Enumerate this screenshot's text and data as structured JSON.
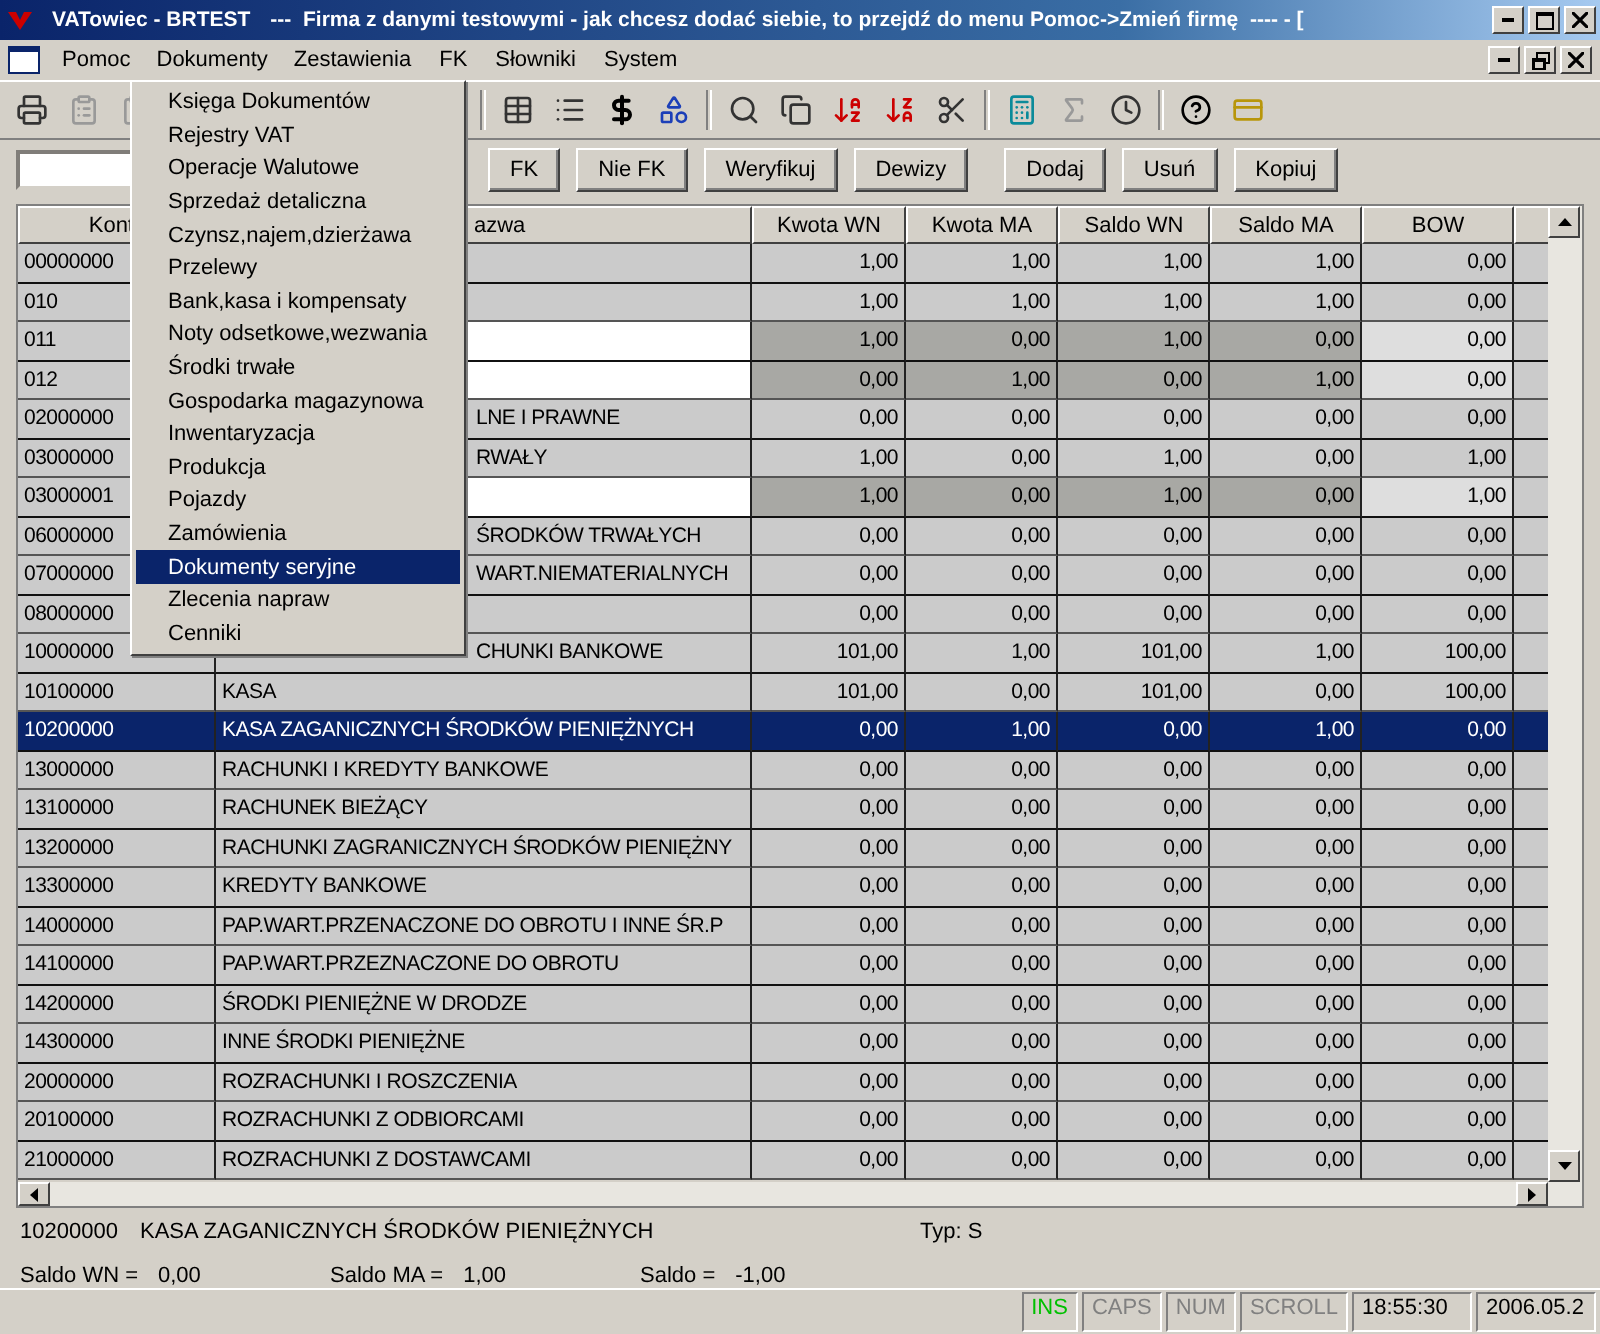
{
  "window": {
    "title": "VATowiec - BRTEST",
    "caption": "---  Firma z danymi testowymi - jak chcesz dodać siebie, to przejdź do menu Pomoc->Zmień firmę  ---- - ["
  },
  "menu": [
    {
      "label": "Pomoc",
      "selected": false
    },
    {
      "label": "Dokumenty",
      "selected": true
    },
    {
      "label": "Zestawienia",
      "selected": false
    },
    {
      "label": "FK",
      "selected": false
    },
    {
      "label": "Słowniki",
      "selected": false
    },
    {
      "label": "System",
      "selected": false
    }
  ],
  "dropdown": [
    {
      "label": "Księga Dokumentów",
      "selected": false
    },
    {
      "label": "Rejestry VAT",
      "selected": false
    },
    {
      "label": "Operacje Walutowe",
      "selected": false
    },
    {
      "label": "Sprzedaż detaliczna",
      "selected": false
    },
    {
      "label": "Czynsz,najem,dzierżawa",
      "selected": false
    },
    {
      "label": "Przelewy",
      "selected": false
    },
    {
      "label": "Bank,kasa i kompensaty",
      "selected": false
    },
    {
      "label": "Noty odsetkowe,wezwania",
      "selected": false
    },
    {
      "label": "Środki trwałe",
      "selected": false
    },
    {
      "label": "Gospodarka magazynowa",
      "selected": false
    },
    {
      "label": "Inwentaryzacja",
      "selected": false
    },
    {
      "label": "Produkcja",
      "selected": false
    },
    {
      "label": "Pojazdy",
      "selected": false
    },
    {
      "label": "Zamówienia",
      "selected": false
    },
    {
      "label": "Dokumenty seryjne",
      "selected": true
    },
    {
      "label": "Zlecenia napraw",
      "selected": false
    },
    {
      "label": "Cenniki",
      "selected": false
    }
  ],
  "buttons": [
    "FK",
    "Nie FK",
    "Weryfikuj",
    "Dewizy",
    "Dodaj",
    "Usuń",
    "Kopiuj"
  ],
  "table": {
    "columns": [
      "Kont",
      "azwa",
      "Kwota WN",
      "Kwota MA",
      "Saldo WN",
      "Saldo MA",
      "BOW"
    ],
    "rows": [
      {
        "code": "00000000",
        "values": [
          "1,00",
          "1,00",
          "1,00",
          "1,00",
          "0,00"
        ],
        "kind": "normal",
        "selected": false
      },
      {
        "code": "010",
        "values": [
          "1,00",
          "1,00",
          "1,00",
          "1,00",
          "0,00"
        ],
        "kind": "normal",
        "selected": false
      },
      {
        "code": "011",
        "values": [
          "1,00",
          "0,00",
          "1,00",
          "0,00",
          "0,00"
        ],
        "kind": "marked",
        "selected": false
      },
      {
        "code": "012",
        "values": [
          "0,00",
          "1,00",
          "0,00",
          "1,00",
          "0,00"
        ],
        "kind": "marked",
        "selected": false
      },
      {
        "code": "02000000",
        "name": "LNE I PRAWNE",
        "values": [
          "0,00",
          "0,00",
          "0,00",
          "0,00",
          "0,00"
        ],
        "kind": "normal",
        "selected": false
      },
      {
        "code": "03000000",
        "name": "RWAŁY",
        "values": [
          "1,00",
          "0,00",
          "1,00",
          "0,00",
          "1,00"
        ],
        "kind": "normal",
        "selected": false
      },
      {
        "code": "03000001",
        "values": [
          "1,00",
          "0,00",
          "1,00",
          "0,00",
          "1,00"
        ],
        "kind": "marked",
        "selected": false
      },
      {
        "code": "06000000",
        "name": "ŚRODKÓW TRWAŁYCH",
        "values": [
          "0,00",
          "0,00",
          "0,00",
          "0,00",
          "0,00"
        ],
        "kind": "normal",
        "selected": false
      },
      {
        "code": "07000000",
        "name": "WART.NIEMATERIALNYCH",
        "values": [
          "0,00",
          "0,00",
          "0,00",
          "0,00",
          "0,00"
        ],
        "kind": "normal",
        "selected": false
      },
      {
        "code": "08000000",
        "values": [
          "0,00",
          "0,00",
          "0,00",
          "0,00",
          "0,00"
        ],
        "kind": "normal",
        "selected": false
      },
      {
        "code": "10000000",
        "name": "CHUNKI BANKOWE",
        "values": [
          "101,00",
          "1,00",
          "101,00",
          "1,00",
          "100,00"
        ],
        "kind": "normal",
        "selected": false
      },
      {
        "code": "10100000",
        "name": "KASA",
        "values": [
          "101,00",
          "0,00",
          "101,00",
          "0,00",
          "100,00"
        ],
        "kind": "normal",
        "selected": false
      },
      {
        "code": "10200000",
        "name": "KASA ZAGANICZNYCH ŚRODKÓW PIENIĘŻNYCH",
        "values": [
          "0,00",
          "1,00",
          "0,00",
          "1,00",
          "0,00"
        ],
        "kind": "normal",
        "selected": true
      },
      {
        "code": "13000000",
        "name": "RACHUNKI I KREDYTY BANKOWE",
        "values": [
          "0,00",
          "0,00",
          "0,00",
          "0,00",
          "0,00"
        ],
        "kind": "normal",
        "selected": false
      },
      {
        "code": "13100000",
        "name": "RACHUNEK BIEŻĄCY",
        "values": [
          "0,00",
          "0,00",
          "0,00",
          "0,00",
          "0,00"
        ],
        "kind": "normal",
        "selected": false
      },
      {
        "code": "13200000",
        "name": "RACHUNKI ZAGRANICZNYCH ŚRODKÓW PIENIĘŻNY",
        "values": [
          "0,00",
          "0,00",
          "0,00",
          "0,00",
          "0,00"
        ],
        "kind": "normal",
        "selected": false
      },
      {
        "code": "13300000",
        "name": "KREDYTY BANKOWE",
        "values": [
          "0,00",
          "0,00",
          "0,00",
          "0,00",
          "0,00"
        ],
        "kind": "normal",
        "selected": false
      },
      {
        "code": "14000000",
        "name": "PAP.WART.PRZENACZONE DO OBROTU I INNE ŚR.P",
        "values": [
          "0,00",
          "0,00",
          "0,00",
          "0,00",
          "0,00"
        ],
        "kind": "normal",
        "selected": false
      },
      {
        "code": "14100000",
        "name": "PAP.WART.PRZEZNACZONE DO OBROTU",
        "values": [
          "0,00",
          "0,00",
          "0,00",
          "0,00",
          "0,00"
        ],
        "kind": "normal",
        "selected": false
      },
      {
        "code": "14200000",
        "name": "ŚRODKI PIENIĘŻNE W DRODZE",
        "values": [
          "0,00",
          "0,00",
          "0,00",
          "0,00",
          "0,00"
        ],
        "kind": "normal",
        "selected": false
      },
      {
        "code": "14300000",
        "name": "INNE ŚRODKI PIENIĘŻNE",
        "values": [
          "0,00",
          "0,00",
          "0,00",
          "0,00",
          "0,00"
        ],
        "kind": "normal",
        "selected": false
      },
      {
        "code": "20000000",
        "name": "ROZRACHUNKI I ROSZCZENIA",
        "values": [
          "0,00",
          "0,00",
          "0,00",
          "0,00",
          "0,00"
        ],
        "kind": "normal",
        "selected": false
      },
      {
        "code": "20100000",
        "name": "ROZRACHUNKI Z ODBIORCAMI",
        "values": [
          "0,00",
          "0,00",
          "0,00",
          "0,00",
          "0,00"
        ],
        "kind": "normal",
        "selected": false
      },
      {
        "code": "21000000",
        "name": "ROZRACHUNKI Z DOSTAWCAMI",
        "values": [
          "0,00",
          "0,00",
          "0,00",
          "0,00",
          "0,00"
        ],
        "kind": "normal",
        "selected": false
      }
    ]
  },
  "details": {
    "code": "10200000",
    "name": "KASA ZAGANICZNYCH ŚRODKÓW PIENIĘŻNYCH",
    "type": "Typ: S",
    "sums": [
      {
        "label": "Saldo WN =",
        "value": "0,00"
      },
      {
        "label": "Saldo MA =",
        "value": "1,00"
      },
      {
        "label": "Saldo =",
        "value": "-1,00"
      }
    ]
  },
  "status_bar": {
    "indicators": [
      {
        "label": "INS",
        "on": true
      },
      {
        "label": "CAPS",
        "on": false
      },
      {
        "label": "NUM",
        "on": false
      },
      {
        "label": "SCROLL",
        "on": false
      }
    ],
    "time": "18:55:30",
    "date": "2006.05.2"
  }
}
